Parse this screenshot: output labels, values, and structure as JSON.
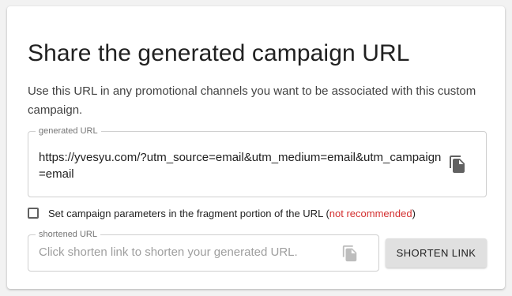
{
  "panel": {
    "title": "Share the generated campaign URL",
    "description": "Use this URL in any promotional channels you want to be associated with this custom campaign."
  },
  "generated_url": {
    "legend": "generated URL",
    "value": "https://yvesyu.com/?utm_source=email&utm_medium=email&utm_campaign=email",
    "copy_icon": "content-copy-icon"
  },
  "fragment_option": {
    "checked": false,
    "label": "Set campaign parameters in the fragment portion of the URL",
    "open_paren": "(",
    "warning": "not recommended",
    "close_paren": ")",
    "warning_color": "#d32f2f"
  },
  "shortened_url": {
    "legend": "shortened URL",
    "placeholder": "Click shorten link to shorten your generated URL.",
    "value": "",
    "copy_icon": "content-copy-icon"
  },
  "shorten_button": {
    "label": "SHORTEN LINK"
  }
}
